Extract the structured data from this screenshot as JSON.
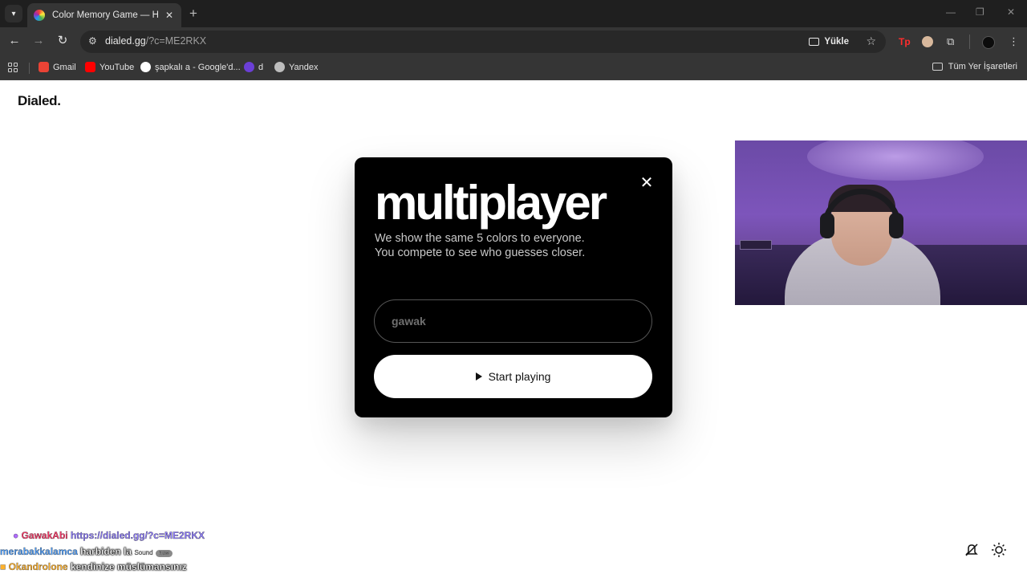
{
  "browser": {
    "tab_title": "Color Memory Game — How W",
    "url_host": "dialed.gg",
    "url_path": "/?c=ME2RKX",
    "install_label": "Yükle",
    "bookmarks": [
      {
        "label": "Gmail",
        "color": "#ea4335"
      },
      {
        "label": "YouTube",
        "color": "#ff0000"
      },
      {
        "label": "şapkalı a - Google'd...",
        "color": "#4285f4"
      },
      {
        "label": "d",
        "color": "#6b3fd6"
      },
      {
        "label": "Yandex",
        "color": "#bdbdbd"
      }
    ],
    "all_bookmarks_label": "Tüm Yer İşaretleri"
  },
  "page": {
    "logo": "Dialed."
  },
  "modal": {
    "title": "multiplayer",
    "description_line1": "We show the same 5 colors to everyone.",
    "description_line2": "You compete to see who guesses closer.",
    "name_placeholder": "gawak",
    "start_label": "Start playing",
    "close_icon": "close-icon"
  },
  "chat": [
    {
      "user": "GawakAbi",
      "message": "https://dialed.gg/?c=ME2RKX"
    },
    {
      "user": "merabakkalamca",
      "message": "harbiden la",
      "extra": "Sound",
      "badge": "new"
    },
    {
      "user": "Okandrolone",
      "message": "kendinize müslümansınız"
    }
  ],
  "colors": {
    "accent": "#000000",
    "chrome_dark": "#353535",
    "tabbar": "#1f1f1f"
  }
}
